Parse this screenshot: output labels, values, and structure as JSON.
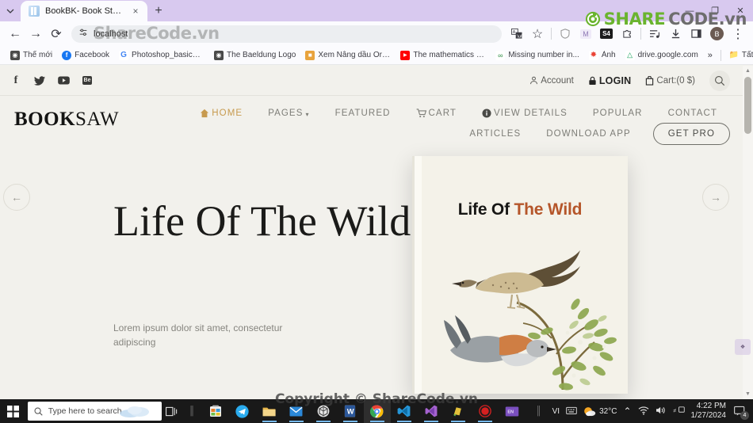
{
  "browser": {
    "tab": {
      "title": "BookBK- Book Store",
      "favicon": "book-favicon",
      "close": "×"
    },
    "newtab_label": "+",
    "tab_list_icon": "⌄",
    "window_controls": {
      "minimize": "—",
      "maximize": "❐",
      "close": "✕"
    },
    "nav": {
      "back": "←",
      "forward": "→",
      "reload": "⟳"
    },
    "omnibox": {
      "site_settings_icon": "tune-icon",
      "url": "localhost",
      "translate_icon": "translate-icon",
      "bookmark_icon": "☆"
    },
    "extensions": [
      {
        "name": "shield-extension-icon",
        "glyph": "○"
      },
      {
        "name": "m-extension-icon",
        "glyph": "M"
      },
      {
        "name": "s4-extension-icon",
        "glyph": "S4"
      },
      {
        "name": "puzzle-extension-icon",
        "glyph": "⬚"
      }
    ],
    "toolbar_right": [
      {
        "name": "reading-list-icon",
        "glyph": "≡"
      },
      {
        "name": "downloads-icon",
        "glyph": "⬇"
      },
      {
        "name": "side-panel-icon",
        "glyph": "◪"
      }
    ],
    "profile_initial": "B",
    "menu_icon": "⋮",
    "bookmarks": [
      {
        "label": "Thế mới",
        "icon": "globe-icon",
        "color": "#4a4a4a",
        "glyph": "◐"
      },
      {
        "label": "Facebook",
        "icon": "facebook-icon",
        "color": "#1877f2",
        "glyph": "f"
      },
      {
        "label": "Photoshop_basic_fo...",
        "icon": "google-icon",
        "color": "#ffffff",
        "glyph": "G"
      },
      {
        "label": "The Baeldung Logo",
        "icon": "globe-icon",
        "color": "#4a4a4a",
        "glyph": "◐"
      },
      {
        "label": "Xem Nâng dầu Ord...",
        "icon": "folder-icon",
        "color": "#e8a33d",
        "glyph": "■"
      },
      {
        "label": "The mathematics of...",
        "icon": "youtube-icon",
        "color": "#ff0000",
        "glyph": "▶"
      },
      {
        "label": "Missing number in...",
        "icon": "geeks-icon",
        "color": "#2f8d46",
        "glyph": "∞"
      },
      {
        "label": "Ảnh",
        "icon": "google-photos-icon",
        "color": "#ffffff",
        "glyph": "✸"
      },
      {
        "label": "drive.google.com",
        "icon": "google-drive-icon",
        "color": "#ffffff",
        "glyph": "△"
      }
    ],
    "bookmarks_overflow": "»",
    "all_bookmarks": {
      "label": "Tất cả dấu trang",
      "icon": "folder-icon"
    }
  },
  "site": {
    "topbar": {
      "socials": [
        {
          "name": "facebook-icon",
          "glyph": "f"
        },
        {
          "name": "twitter-icon",
          "glyph": "🐦"
        },
        {
          "name": "youtube-icon",
          "glyph": "▶"
        },
        {
          "name": "behance-icon",
          "glyph": "Be"
        }
      ],
      "account_label": "Account",
      "login_label": "LOGIN",
      "cart_label": "Cart:(0 $)",
      "search_icon": "search-icon"
    },
    "brand": {
      "bold": "BOOK",
      "light": "SAW"
    },
    "nav_row_1": [
      {
        "label": "HOME",
        "icon": "home-icon",
        "active": true
      },
      {
        "label": "PAGES",
        "caret": "▾",
        "active": false
      },
      {
        "label": "FEATURED",
        "active": false
      },
      {
        "label": "CART",
        "icon": "cart-icon",
        "active": false
      },
      {
        "label": "VIEW DETAILS",
        "icon": "info-icon",
        "active": false
      },
      {
        "label": "POPULAR",
        "active": false
      },
      {
        "label": "CONTACT",
        "active": false
      }
    ],
    "nav_row_2": [
      {
        "label": "ARTICLES"
      },
      {
        "label": "DOWNLOAD APP"
      }
    ],
    "cta_label": "GET PRO",
    "hero": {
      "title": "Life Of The Wild",
      "subtitle": "Lorem ipsum dolor sit amet, consectetur adipiscing",
      "prev_arrow": "←",
      "next_arrow": "→",
      "book_cover": {
        "title_dark": "Life Of",
        "title_accent": "The Wild"
      }
    },
    "colors": {
      "accent": "#c79a4e",
      "book_accent": "#b5562a",
      "page_bg": "#f2f1ec"
    }
  },
  "taskbar": {
    "start_icon": "windows-icon",
    "search_placeholder": "Type here to search",
    "search_icon": "search-icon",
    "task_view_icon": "task-view-icon",
    "apps": [
      {
        "name": "store-icon",
        "glyph": "▦",
        "color": "#f0a020"
      },
      {
        "name": "telegram-icon",
        "glyph": "➤",
        "color": "#2aabee"
      },
      {
        "name": "file-explorer-icon",
        "glyph": "🗀",
        "color": "#e8b64a"
      },
      {
        "name": "mail-icon",
        "glyph": "✉",
        "color": "#2b88d8"
      },
      {
        "name": "unity-icon",
        "glyph": "⬢",
        "color": "#dedede"
      },
      {
        "name": "word-icon",
        "glyph": "W",
        "color": "#2b579a"
      },
      {
        "name": "chrome-icon",
        "glyph": "◉",
        "color": "#4285f4"
      },
      {
        "name": "vscode-icon",
        "glyph": "✕",
        "color": "#2596d8"
      },
      {
        "name": "visual-studio-icon",
        "glyph": "N",
        "color": "#a663d0"
      },
      {
        "name": "sticky-notes-icon",
        "glyph": "✷",
        "color": "#e3c03a"
      },
      {
        "name": "record-icon",
        "glyph": "●",
        "color": "#d62020"
      },
      {
        "name": "evernote-icon",
        "glyph": "EN",
        "color": "#7a4fbf"
      }
    ],
    "tray": {
      "input_indicator": "VI",
      "ime_icon": "keyboard-icon",
      "weather_temp": "32°C",
      "weather_icon": "sun-cloud-icon",
      "chevron": "⌃",
      "wifi_icon": "wifi-icon",
      "volume_icon": "volume-icon",
      "network_icon": "network-icon",
      "time": "4:22 PM",
      "date": "1/27/2024",
      "notification_count": "4"
    }
  },
  "watermarks": {
    "url_overlay": "ShareCode.vn",
    "top_logo_green": "SHARE",
    "top_logo_dark": "CODE.vn",
    "bottom": "Copyright © ShareCode.vn"
  }
}
